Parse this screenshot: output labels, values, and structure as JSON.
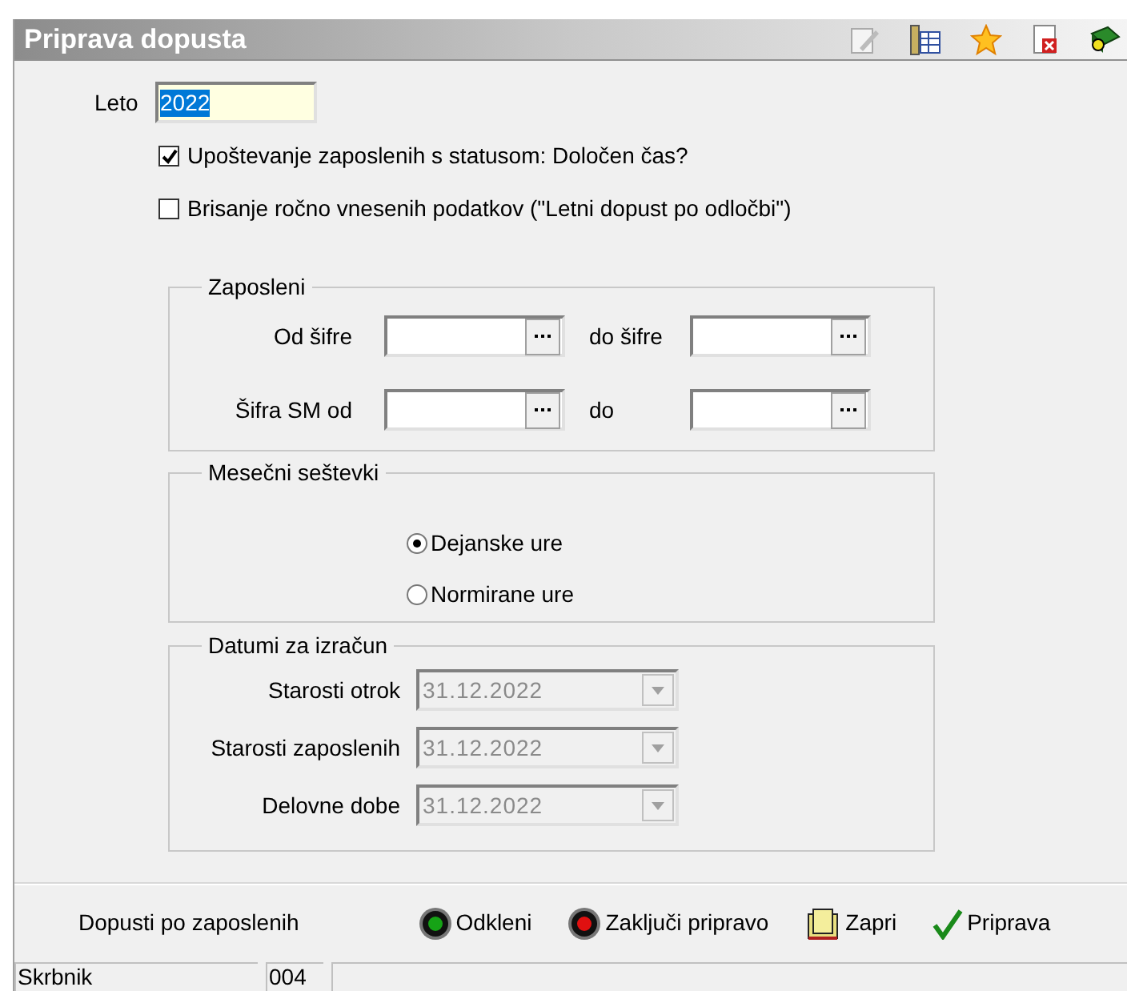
{
  "window": {
    "title": "Priprava dopusta"
  },
  "year": {
    "label": "Leto",
    "value": "2022"
  },
  "options": [
    {
      "label": "Upoštevanje zaposlenih s statusom: Določen čas?",
      "checked": true
    },
    {
      "label": "Brisanje ročno vnesenih podatkov (\"Letni dopust po odločbi\")",
      "checked": false
    }
  ],
  "employees": {
    "title": "Zaposleni",
    "rows": [
      {
        "label": "Od šifre",
        "to_label": "do šifre"
      },
      {
        "label": "Šifra SM od",
        "to_label": "do"
      }
    ]
  },
  "monthly_sums": {
    "title": "Mesečni seštevki",
    "options": [
      {
        "label": "Dejanske ure",
        "selected": true
      },
      {
        "label": "Normirane ure",
        "selected": false
      }
    ]
  },
  "dates": {
    "title": "Datumi za izračun",
    "rows": [
      {
        "label": "Starosti otrok",
        "value": "31.12.2022",
        "disabled": true
      },
      {
        "label": "Starosti zaposlenih",
        "value": "31.12.2022",
        "disabled": true
      },
      {
        "label": "Delovne dobe",
        "value": "31.12.2022",
        "disabled": true
      }
    ]
  },
  "actions": [
    {
      "kind": "text",
      "label": "Dopusti po zaposlenih"
    },
    {
      "kind": "green",
      "label": "Odkleni"
    },
    {
      "kind": "red",
      "label": "Zaključi pripravo"
    },
    {
      "kind": "close",
      "label": "Zapri"
    },
    {
      "kind": "check",
      "label": "Priprava"
    }
  ],
  "status_bar": [
    "Skrbnik",
    "004"
  ]
}
